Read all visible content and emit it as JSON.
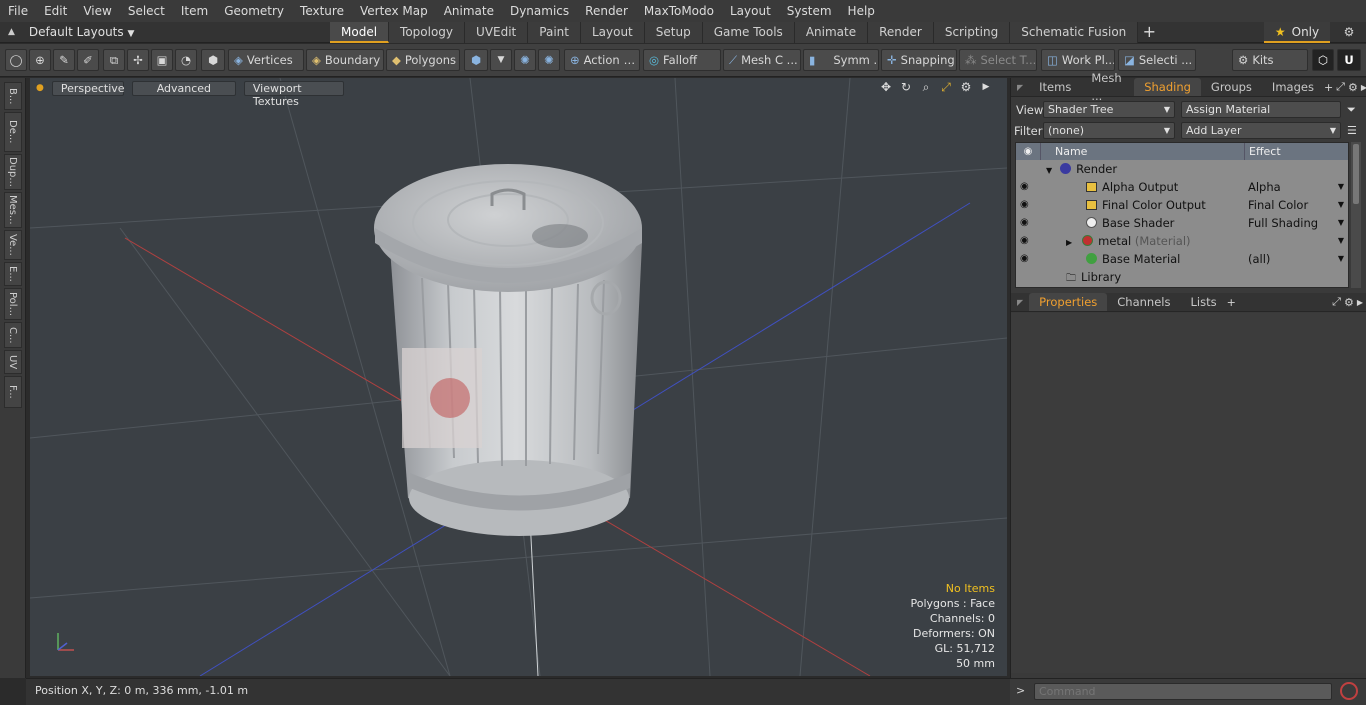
{
  "menu": [
    "File",
    "Edit",
    "View",
    "Select",
    "Item",
    "Geometry",
    "Texture",
    "Vertex Map",
    "Animate",
    "Dynamics",
    "Render",
    "MaxToModo",
    "Layout",
    "System",
    "Help"
  ],
  "layouts": {
    "label": "Default Layouts"
  },
  "tabs": [
    "Model",
    "Topology",
    "UVEdit",
    "Paint",
    "Layout",
    "Setup",
    "Game Tools",
    "Animate",
    "Render",
    "Scripting",
    "Schematic Fusion"
  ],
  "only_label": "Only",
  "toolbar": {
    "vertices": "Vertices",
    "boundary": "Boundary",
    "polygons": "Polygons",
    "action": "Action",
    "falloff": "Falloff",
    "mesh_c": "Mesh C ...",
    "symm": "Symm ...",
    "snapping": "Snapping",
    "select_t": "Select T...",
    "work_pl": "Work Pl...",
    "selecti": "Selecti ...",
    "kits": "Kits"
  },
  "left_tabs": [
    "B...",
    "De...",
    "Dup...",
    "Mes...",
    "Ve...",
    "E...",
    "Pol...",
    "C...",
    "UV",
    "F..."
  ],
  "viewport": {
    "view_mode": "Perspective",
    "advanced": "Advanced",
    "textures": "Viewport Textures",
    "info": {
      "items": "No Items",
      "polygons": "Polygons : Face",
      "channels": "Channels: 0",
      "deformers": "Deformers: ON",
      "gl": "GL: 51,712",
      "scale": "50 mm"
    }
  },
  "status": {
    "position": "Position X, Y, Z:   0 m, 336 mm, -1.01 m"
  },
  "right": {
    "tabs": [
      "Items",
      "Mesh ...",
      "Shading",
      "Groups",
      "Images"
    ],
    "view_label": "View",
    "view_value": "Shader Tree",
    "assign_material": "Assign Material",
    "filter_label": "Filter",
    "filter_value": "(none)",
    "add_layer": "Add Layer",
    "columns": {
      "name": "Name",
      "effect": "Effect"
    },
    "rows": [
      {
        "name": "Render",
        "effect": ""
      },
      {
        "name": "Alpha Output",
        "effect": "Alpha"
      },
      {
        "name": "Final Color Output",
        "effect": "Final Color"
      },
      {
        "name": "Base Shader",
        "effect": "Full Shading"
      },
      {
        "name": "metal",
        "suffix": "(Material)",
        "effect": ""
      },
      {
        "name": "Base Material",
        "effect": "(all)"
      },
      {
        "name": "Library",
        "effect": ""
      }
    ],
    "prop_tabs": [
      "Properties",
      "Channels",
      "Lists"
    ],
    "command_placeholder": "Command"
  }
}
